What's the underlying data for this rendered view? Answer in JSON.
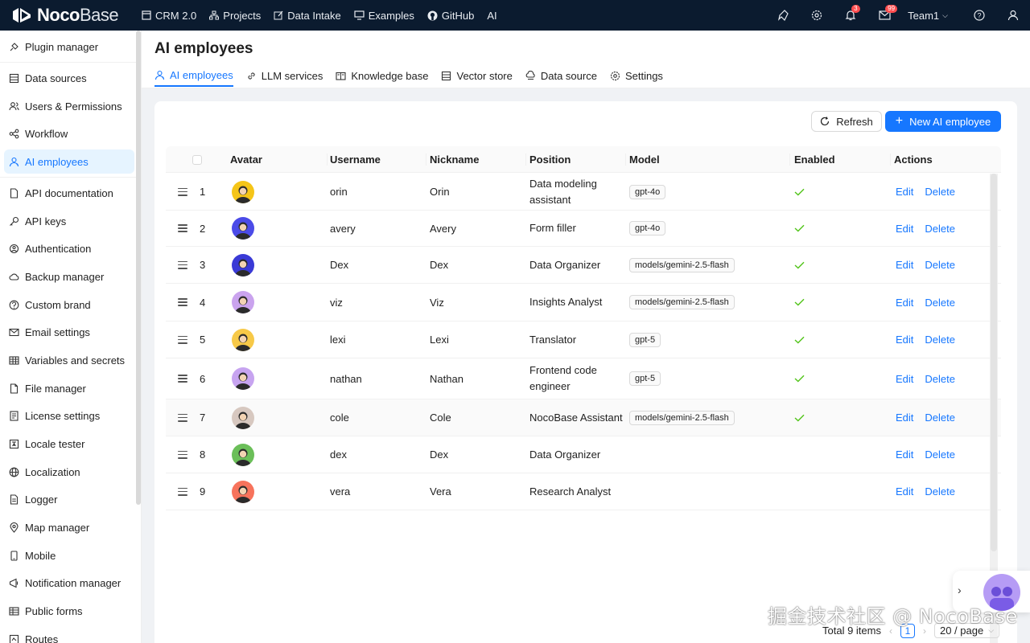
{
  "topbar": {
    "logo_bold": "Noco",
    "logo_thin": "Base",
    "nav": [
      {
        "label": "CRM 2.0",
        "icon": "app-icon"
      },
      {
        "label": "Projects",
        "icon": "hierarchy-icon"
      },
      {
        "label": "Data Intake",
        "icon": "edit-icon"
      },
      {
        "label": "Examples",
        "icon": "desktop-icon"
      },
      {
        "label": "GitHub",
        "icon": "github-icon"
      },
      {
        "label": "AI",
        "icon": ""
      }
    ],
    "notifications_badge": "3",
    "mail_badge": "99",
    "team": "Team1"
  },
  "sidebar": {
    "items": [
      {
        "label": "Plugin manager",
        "icon": "plug-icon"
      },
      {
        "label": "Data sources",
        "icon": "database-icon"
      },
      {
        "label": "Users & Permissions",
        "icon": "users-icon"
      },
      {
        "label": "Workflow",
        "icon": "workflow-icon"
      },
      {
        "label": "AI employees",
        "icon": "robot-icon",
        "active": true
      },
      {
        "label": "API documentation",
        "icon": "document-icon"
      },
      {
        "label": "API keys",
        "icon": "key-icon"
      },
      {
        "label": "Authentication",
        "icon": "lock-icon"
      },
      {
        "label": "Backup manager",
        "icon": "cloud-icon"
      },
      {
        "label": "Custom brand",
        "icon": "brand-icon"
      },
      {
        "label": "Email settings",
        "icon": "mail-icon"
      },
      {
        "label": "Variables and secrets",
        "icon": "table-icon"
      },
      {
        "label": "File manager",
        "icon": "file-icon"
      },
      {
        "label": "License settings",
        "icon": "license-icon"
      },
      {
        "label": "Locale tester",
        "icon": "locale-icon"
      },
      {
        "label": "Localization",
        "icon": "globe-icon"
      },
      {
        "label": "Logger",
        "icon": "log-icon"
      },
      {
        "label": "Map manager",
        "icon": "map-pin-icon"
      },
      {
        "label": "Mobile",
        "icon": "mobile-icon"
      },
      {
        "label": "Notification manager",
        "icon": "notification-icon"
      },
      {
        "label": "Public forms",
        "icon": "form-icon"
      },
      {
        "label": "Routes",
        "icon": "routes-icon"
      }
    ]
  },
  "page": {
    "title": "AI employees",
    "tabs": [
      {
        "label": "AI employees",
        "icon": "robot-icon",
        "active": true
      },
      {
        "label": "LLM services",
        "icon": "link-icon"
      },
      {
        "label": "Knowledge base",
        "icon": "book-icon"
      },
      {
        "label": "Vector store",
        "icon": "database-icon"
      },
      {
        "label": "Data source",
        "icon": "cloud-server-icon"
      },
      {
        "label": "Settings",
        "icon": "gear-icon"
      }
    ],
    "refresh_label": "Refresh",
    "new_label": "New AI employee"
  },
  "table": {
    "columns": [
      "Avatar",
      "Username",
      "Nickname",
      "Position",
      "Model",
      "Enabled",
      "Actions"
    ],
    "edit_label": "Edit",
    "delete_label": "Delete",
    "rows": [
      {
        "index": "1",
        "username": "orin",
        "nickname": "Orin",
        "position": "Data modeling assistant",
        "model": "gpt-4o",
        "enabled": true,
        "avatar_color": "#f5c518"
      },
      {
        "index": "2",
        "username": "avery",
        "nickname": "Avery",
        "position": "Form filler",
        "model": "gpt-4o",
        "enabled": true,
        "avatar_color": "#4b4be8"
      },
      {
        "index": "3",
        "username": "Dex",
        "nickname": "Dex",
        "position": "Data Organizer",
        "model": "models/gemini-2.5-flash",
        "enabled": true,
        "avatar_color": "#3a3ad6"
      },
      {
        "index": "4",
        "username": "viz",
        "nickname": "Viz",
        "position": "Insights Analyst",
        "model": "models/gemini-2.5-flash",
        "enabled": true,
        "avatar_color": "#caa3ee"
      },
      {
        "index": "5",
        "username": "lexi",
        "nickname": "Lexi",
        "position": "Translator",
        "model": "gpt-5",
        "enabled": true,
        "avatar_color": "#f7c948"
      },
      {
        "index": "6",
        "username": "nathan",
        "nickname": "Nathan",
        "position": "Frontend code engineer",
        "model": "gpt-5",
        "enabled": true,
        "avatar_color": "#c7a4f0"
      },
      {
        "index": "7",
        "username": "cole",
        "nickname": "Cole",
        "position": "NocoBase Assistant",
        "model": "models/gemini-2.5-flash",
        "enabled": true,
        "avatar_color": "#d7c8c0"
      },
      {
        "index": "8",
        "username": "dex",
        "nickname": "Dex",
        "position": "Data Organizer",
        "model": "",
        "enabled": false,
        "avatar_color": "#6bbf59"
      },
      {
        "index": "9",
        "username": "vera",
        "nickname": "Vera",
        "position": "Research Analyst",
        "model": "",
        "enabled": false,
        "avatar_color": "#f7735c"
      }
    ]
  },
  "pagination": {
    "total": "Total 9 items",
    "current": "1",
    "page_size": "20 / page"
  },
  "watermark": "掘金技术社区 @ NocoBase",
  "colors": {
    "primary": "#1677ff",
    "topbar": "#0b1b2f",
    "success": "#52c41a"
  }
}
